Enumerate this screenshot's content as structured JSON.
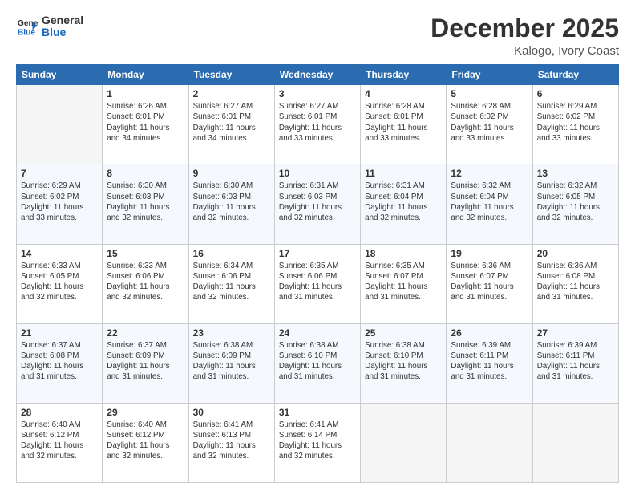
{
  "logo": {
    "line1": "General",
    "line2": "Blue"
  },
  "title": "December 2025",
  "subtitle": "Kalogo, Ivory Coast",
  "weekdays": [
    "Sunday",
    "Monday",
    "Tuesday",
    "Wednesday",
    "Thursday",
    "Friday",
    "Saturday"
  ],
  "weeks": [
    [
      {
        "day": "",
        "empty": true
      },
      {
        "day": "1",
        "sunrise": "6:26 AM",
        "sunset": "6:01 PM",
        "daylight": "11 hours and 34 minutes."
      },
      {
        "day": "2",
        "sunrise": "6:27 AM",
        "sunset": "6:01 PM",
        "daylight": "11 hours and 34 minutes."
      },
      {
        "day": "3",
        "sunrise": "6:27 AM",
        "sunset": "6:01 PM",
        "daylight": "11 hours and 33 minutes."
      },
      {
        "day": "4",
        "sunrise": "6:28 AM",
        "sunset": "6:01 PM",
        "daylight": "11 hours and 33 minutes."
      },
      {
        "day": "5",
        "sunrise": "6:28 AM",
        "sunset": "6:02 PM",
        "daylight": "11 hours and 33 minutes."
      },
      {
        "day": "6",
        "sunrise": "6:29 AM",
        "sunset": "6:02 PM",
        "daylight": "11 hours and 33 minutes."
      }
    ],
    [
      {
        "day": "7",
        "sunrise": "6:29 AM",
        "sunset": "6:02 PM",
        "daylight": "11 hours and 33 minutes."
      },
      {
        "day": "8",
        "sunrise": "6:30 AM",
        "sunset": "6:03 PM",
        "daylight": "11 hours and 32 minutes."
      },
      {
        "day": "9",
        "sunrise": "6:30 AM",
        "sunset": "6:03 PM",
        "daylight": "11 hours and 32 minutes."
      },
      {
        "day": "10",
        "sunrise": "6:31 AM",
        "sunset": "6:03 PM",
        "daylight": "11 hours and 32 minutes."
      },
      {
        "day": "11",
        "sunrise": "6:31 AM",
        "sunset": "6:04 PM",
        "daylight": "11 hours and 32 minutes."
      },
      {
        "day": "12",
        "sunrise": "6:32 AM",
        "sunset": "6:04 PM",
        "daylight": "11 hours and 32 minutes."
      },
      {
        "day": "13",
        "sunrise": "6:32 AM",
        "sunset": "6:05 PM",
        "daylight": "11 hours and 32 minutes."
      }
    ],
    [
      {
        "day": "14",
        "sunrise": "6:33 AM",
        "sunset": "6:05 PM",
        "daylight": "11 hours and 32 minutes."
      },
      {
        "day": "15",
        "sunrise": "6:33 AM",
        "sunset": "6:06 PM",
        "daylight": "11 hours and 32 minutes."
      },
      {
        "day": "16",
        "sunrise": "6:34 AM",
        "sunset": "6:06 PM",
        "daylight": "11 hours and 32 minutes."
      },
      {
        "day": "17",
        "sunrise": "6:35 AM",
        "sunset": "6:06 PM",
        "daylight": "11 hours and 31 minutes."
      },
      {
        "day": "18",
        "sunrise": "6:35 AM",
        "sunset": "6:07 PM",
        "daylight": "11 hours and 31 minutes."
      },
      {
        "day": "19",
        "sunrise": "6:36 AM",
        "sunset": "6:07 PM",
        "daylight": "11 hours and 31 minutes."
      },
      {
        "day": "20",
        "sunrise": "6:36 AM",
        "sunset": "6:08 PM",
        "daylight": "11 hours and 31 minutes."
      }
    ],
    [
      {
        "day": "21",
        "sunrise": "6:37 AM",
        "sunset": "6:08 PM",
        "daylight": "11 hours and 31 minutes."
      },
      {
        "day": "22",
        "sunrise": "6:37 AM",
        "sunset": "6:09 PM",
        "daylight": "11 hours and 31 minutes."
      },
      {
        "day": "23",
        "sunrise": "6:38 AM",
        "sunset": "6:09 PM",
        "daylight": "11 hours and 31 minutes."
      },
      {
        "day": "24",
        "sunrise": "6:38 AM",
        "sunset": "6:10 PM",
        "daylight": "11 hours and 31 minutes."
      },
      {
        "day": "25",
        "sunrise": "6:38 AM",
        "sunset": "6:10 PM",
        "daylight": "11 hours and 31 minutes."
      },
      {
        "day": "26",
        "sunrise": "6:39 AM",
        "sunset": "6:11 PM",
        "daylight": "11 hours and 31 minutes."
      },
      {
        "day": "27",
        "sunrise": "6:39 AM",
        "sunset": "6:11 PM",
        "daylight": "11 hours and 31 minutes."
      }
    ],
    [
      {
        "day": "28",
        "sunrise": "6:40 AM",
        "sunset": "6:12 PM",
        "daylight": "11 hours and 32 minutes."
      },
      {
        "day": "29",
        "sunrise": "6:40 AM",
        "sunset": "6:12 PM",
        "daylight": "11 hours and 32 minutes."
      },
      {
        "day": "30",
        "sunrise": "6:41 AM",
        "sunset": "6:13 PM",
        "daylight": "11 hours and 32 minutes."
      },
      {
        "day": "31",
        "sunrise": "6:41 AM",
        "sunset": "6:14 PM",
        "daylight": "11 hours and 32 minutes."
      },
      {
        "day": "",
        "empty": true
      },
      {
        "day": "",
        "empty": true
      },
      {
        "day": "",
        "empty": true
      }
    ]
  ]
}
